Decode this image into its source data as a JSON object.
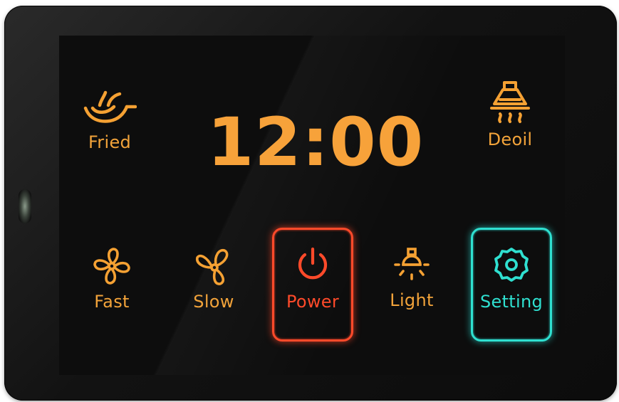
{
  "clock": {
    "time": "12:00"
  },
  "buttons": {
    "fried": {
      "label": "Fried",
      "icon": "wok-icon"
    },
    "deoil": {
      "label": "Deoil",
      "icon": "range-hood-icon"
    },
    "fast": {
      "label": "Fast",
      "icon": "fan-fast-icon"
    },
    "slow": {
      "label": "Slow",
      "icon": "fan-slow-icon"
    },
    "power": {
      "label": "Power",
      "icon": "power-icon",
      "color": "#ff4a2a"
    },
    "light": {
      "label": "Light",
      "icon": "bulb-icon"
    },
    "setting": {
      "label": "Setting",
      "icon": "gear-icon",
      "color": "#2fe0d0"
    }
  },
  "colors": {
    "accent": "#f5a133",
    "background": "#0d0d0d"
  }
}
